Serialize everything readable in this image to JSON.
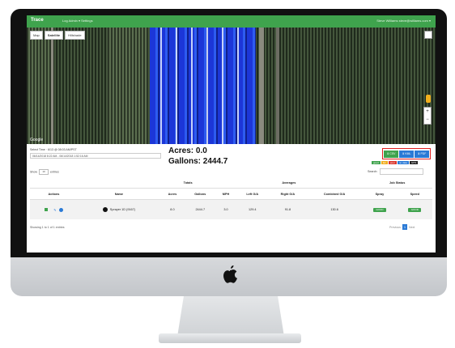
{
  "app": {
    "brand": "Trace",
    "nav": "Log   Admin ▾   Settings",
    "user": "Steve Williams  steve@williams.com ▾"
  },
  "map": {
    "tabs": [
      "Map",
      "Satellite",
      "Hillshade"
    ],
    "active_tab": "Satellite",
    "attribution": "Google"
  },
  "summary": {
    "date_label": "Select Time · 6/13 @ 08:03 AM/PST",
    "date_value": "06/14/2018 8:22 AM - 06/14/2018 1:52:16 AM",
    "acres_text": "Acres: 0.0",
    "gallons_text": "Gallons: 2444.7"
  },
  "export": {
    "buttons": [
      "⬇ CSV",
      "⬇ KML",
      "⬇ PDF"
    ],
    "legend": [
      "good",
      "fair",
      "poor",
      "no data",
      "GPS"
    ]
  },
  "table": {
    "show_label": "Show",
    "show_value": "10",
    "entries_label": "entries",
    "search_label": "Search:",
    "groups": [
      "Totals",
      "Averages",
      "Job Status"
    ],
    "columns": [
      "Actions",
      "Name",
      "Acres",
      "Gallons",
      "MPH",
      "Left G/A",
      "Right G/A",
      "Combined G/A",
      "Spray",
      "Speed"
    ],
    "rows": [
      {
        "name": "Sprayer 1D (9167)",
        "acres": "8.0",
        "gallons": "2444.7",
        "mph": "3.0",
        "left": "129.4",
        "right": "91.8",
        "combined": "130.6",
        "spray": "GOOD",
        "speed": "GOOD"
      }
    ],
    "footer": "Showing 1 to 1 of 1 entries",
    "pager": {
      "prev": "Previous",
      "current": "1",
      "next": "Next"
    }
  },
  "colors": {
    "brand_green": "#3fa34d",
    "accent_blue": "#2a7ad6",
    "highlight_red": "#e02020"
  }
}
